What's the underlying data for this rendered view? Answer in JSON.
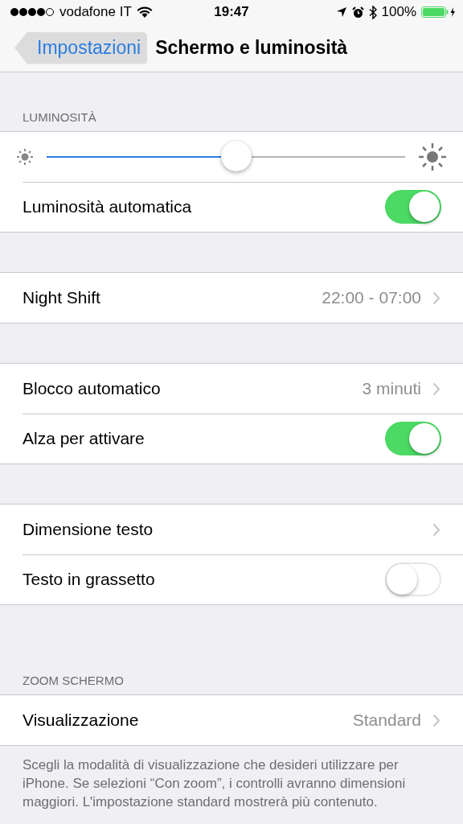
{
  "status_bar": {
    "carrier": "vodafone IT",
    "time": "19:47",
    "battery": "100%"
  },
  "nav": {
    "back": "Impostazioni",
    "title": "Schermo e luminosità"
  },
  "sections": [
    {
      "header": "LUMINOSITÀ",
      "rows": [
        {
          "kind": "slider",
          "level": 0.53
        },
        {
          "kind": "toggle",
          "label": "Luminosità automatica",
          "on": true
        }
      ]
    },
    {
      "rows": [
        {
          "kind": "link",
          "label": "Night Shift",
          "value": "22:00 - 07:00"
        }
      ]
    },
    {
      "rows": [
        {
          "kind": "link",
          "label": "Blocco automatico",
          "value": "3 minuti"
        },
        {
          "kind": "toggle",
          "label": "Alza per attivare",
          "on": true
        }
      ]
    },
    {
      "rows": [
        {
          "kind": "link",
          "label": "Dimensione testo"
        },
        {
          "kind": "toggle",
          "label": "Testo in grassetto",
          "on": false
        }
      ]
    },
    {
      "header": "ZOOM SCHERMO",
      "rows": [
        {
          "kind": "link",
          "label": "Visualizzazione",
          "value": "Standard"
        }
      ],
      "footer": "Scegli la modalità di visualizzazione che desideri utilizzare per iPhone. Se selezioni “Con zoom”, i controlli avranno dimensioni maggiori. L'impostazione standard mostrerà più contenuto."
    }
  ]
}
